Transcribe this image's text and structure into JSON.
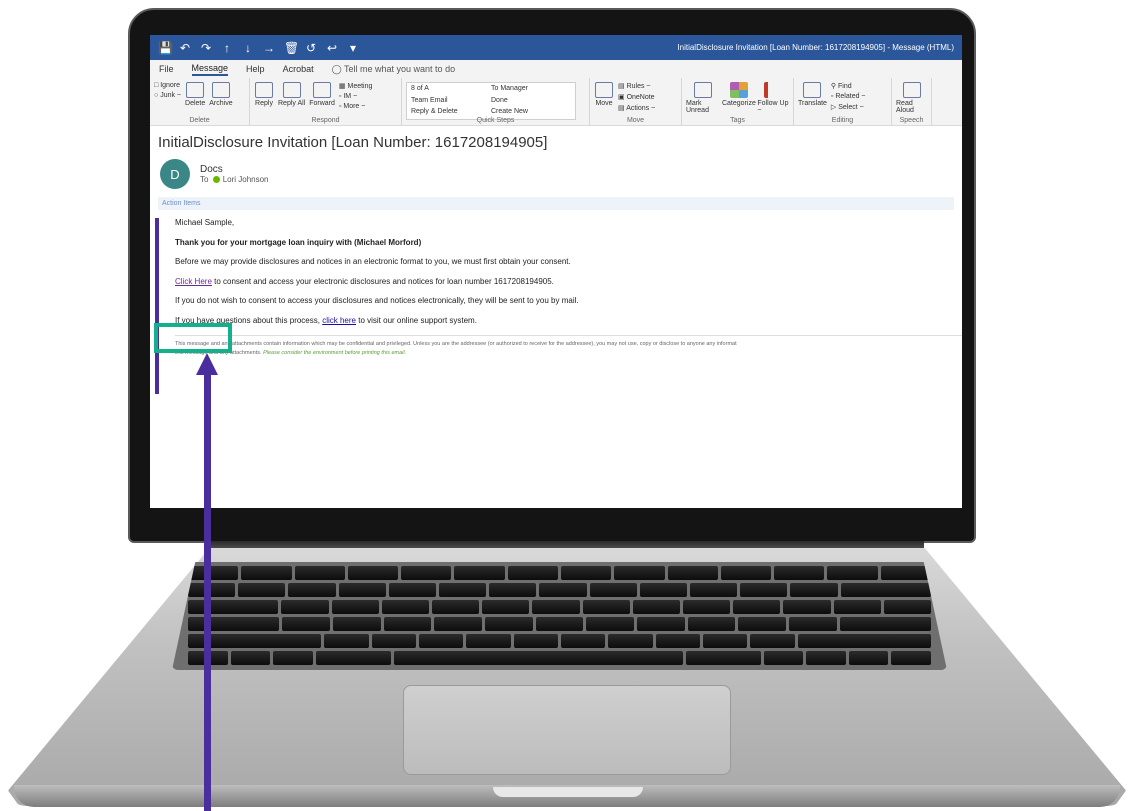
{
  "window": {
    "title": "InitialDisclosure Invitation [Loan Number: 1617208194905]  -  Message (HTML)",
    "quick_access_icons": [
      "save-icon",
      "undo-icon",
      "redo-icon",
      "up-arrow-icon",
      "down-arrow-icon",
      "right-arrow-icon",
      "delete-icon",
      "reply-all-icon",
      "reply-icon",
      "customize-icon"
    ]
  },
  "menu": {
    "items": [
      "File",
      "Message",
      "Help",
      "Acrobat"
    ],
    "active": "Message",
    "tell_me": "Tell me what you want to do"
  },
  "ribbon": {
    "delete_group": {
      "ignore": "Ignore",
      "junk": "Junk ~",
      "delete": "Delete",
      "archive": "Archive",
      "label": "Delete"
    },
    "respond_group": {
      "reply": "Reply",
      "reply_all": "Reply All",
      "forward": "Forward",
      "meeting": "Meeting",
      "im": "IM ~",
      "more": "More ~",
      "label": "Respond"
    },
    "quick_steps_group": {
      "items": [
        "8 of A",
        "To Manager",
        "Team Email",
        "Done",
        "Reply & Delete",
        "Create New"
      ],
      "label": "Quick Steps"
    },
    "move_group": {
      "move": "Move",
      "rules": "Rules ~",
      "onenote": "OneNote",
      "actions": "Actions ~",
      "label": "Move"
    },
    "tags_group": {
      "mark_unread": "Mark Unread",
      "categorize": "Categorize",
      "follow_up": "Follow Up ~",
      "label": "Tags"
    },
    "editing_group": {
      "translate": "Translate",
      "find": "Find",
      "related": "Related ~",
      "select": "Select ~",
      "label": "Editing"
    },
    "speech_group": {
      "read_aloud": "Read Aloud",
      "label": "Speech"
    }
  },
  "message": {
    "subject": "InitialDisclosure Invitation [Loan Number: 1617208194905]",
    "sender_initial": "D",
    "sender_name": "Docs",
    "to_label": "To",
    "recipient": "Lori Johnson",
    "action_items": "Action Items",
    "greeting": "Michael Sample,",
    "thanks": "Thank you for your mortgage loan inquiry with (Michael Morford)",
    "before": "Before we may provide disclosures and notices in an electronic format to you, we must first obtain your consent.",
    "click_here_1": "Click Here",
    "consent_text": " to consent and access your electronic disclosures and notices for loan number 1617208194905.",
    "no_consent": "If you do not wish to consent to access your disclosures and notices electronically, they will be sent to you by mail.",
    "questions_prefix": "If you have questions about this process, ",
    "click_here_2": "click here",
    "questions_suffix": " to visit our online support system.",
    "disclaimer_1": "This message and any attachments contain information which may be confidential and privileged. Unless you are the addressee (or authorized to receive for the addressee), you may not use, copy or disclose to anyone any informat",
    "disclaimer_2": "this message and any attachments. ",
    "disclaimer_green": "Please consider the environment before printing this email."
  },
  "annotation": {
    "highlight_color": "#13b08b",
    "arrow_color": "#4b2e9e"
  },
  "colors": {
    "titlebar": "#2b579a",
    "avatar": "#3b8686",
    "quote_bar": "#4b2e9e"
  }
}
